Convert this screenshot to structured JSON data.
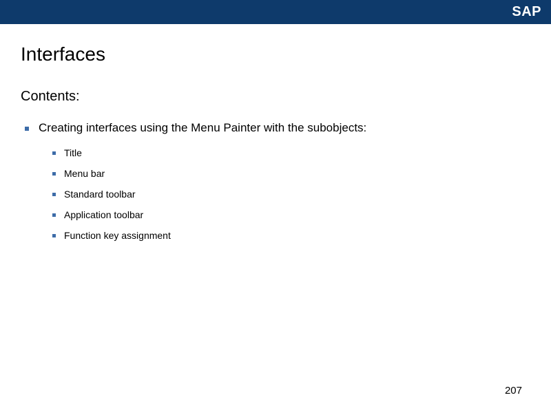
{
  "header": {
    "logo_text": "SAP"
  },
  "slide": {
    "title": "Interfaces",
    "contents_label": "Contents:",
    "top_item": "Creating interfaces using the Menu Painter with the subobjects:",
    "sub_items": [
      "Title",
      "Menu bar",
      "Standard toolbar",
      "Application toolbar",
      "Function key assignment"
    ]
  },
  "page_number": "207"
}
